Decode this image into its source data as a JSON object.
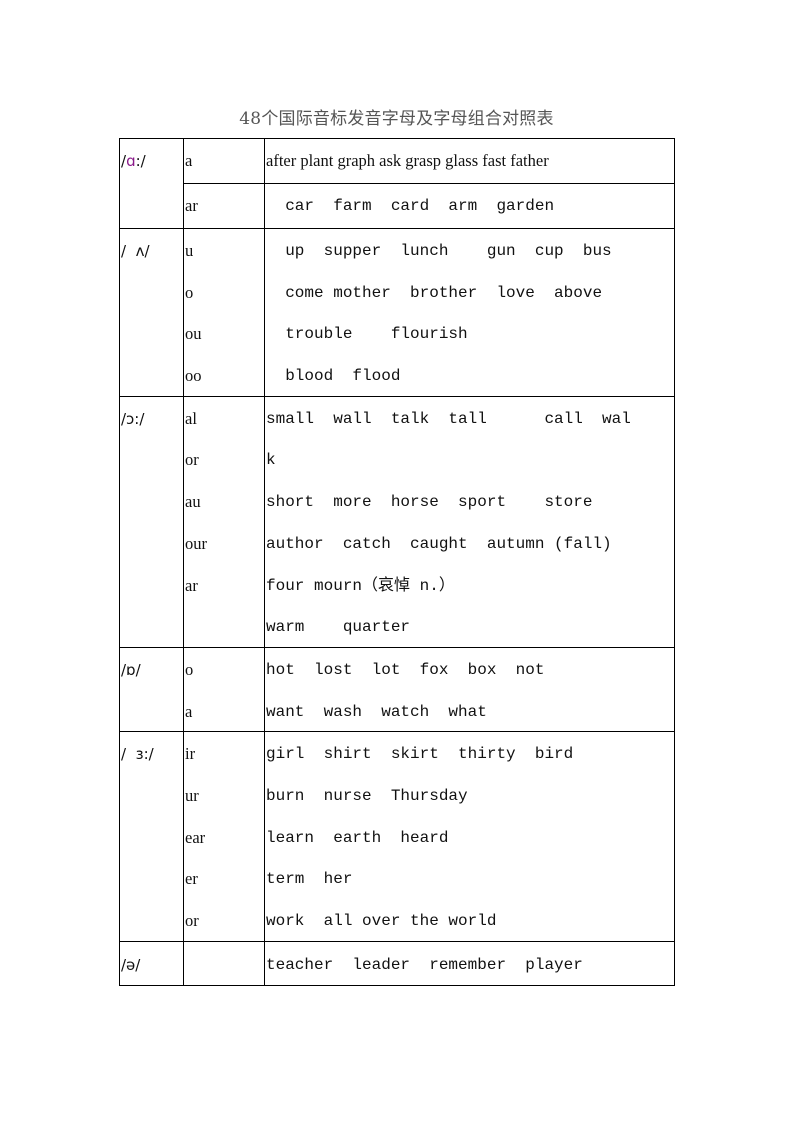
{
  "title": "48个国际音标发音字母及字母组合对照表",
  "accent_color": "#8a1a8a",
  "groups": [
    {
      "symbol_prefix": "/",
      "symbol_highlight": "ɑ",
      "symbol_suffix": ":/",
      "subrows": [
        {
          "letters": [
            "a"
          ],
          "examples": [
            "after plant graph ask grasp glass fast father"
          ]
        },
        {
          "letters": [
            "ar"
          ],
          "examples": [
            "  car  farm  card  arm  garden"
          ]
        }
      ]
    },
    {
      "symbol": "/  ʌ/",
      "letters": [
        "u",
        "o",
        "ou",
        "oo"
      ],
      "examples": [
        "  up  supper  lunch    gun  cup  bus",
        "  come mother  brother  love  above",
        "  trouble    flourish",
        "  blood  flood"
      ]
    },
    {
      "symbol": "/ɔ:/",
      "letters": [
        "al",
        "or",
        "au",
        "our",
        "ar",
        ""
      ],
      "examples": [
        "small  wall  talk  tall      call  wal",
        "k",
        "short  more  horse  sport    store",
        "author  catch  caught  autumn (fall)",
        "four mourn（哀悼 n.）",
        "warm    quarter"
      ]
    },
    {
      "symbol": "/ɒ/",
      "letters": [
        "o",
        "a"
      ],
      "examples": [
        "hot  lost  lot  fox  box  not",
        "want  wash  watch  what"
      ]
    },
    {
      "symbol": "/  ɜ:/",
      "letters": [
        "ir",
        "ur",
        "ear",
        "er",
        "or"
      ],
      "examples": [
        "girl  shirt  skirt  thirty  bird",
        "burn  nurse  Thursday",
        "learn  earth  heard",
        "term  her",
        "work  all over the world"
      ]
    },
    {
      "symbol": "/ə/",
      "letters": [
        ""
      ],
      "examples": [
        "teacher  leader  remember  player"
      ]
    }
  ]
}
